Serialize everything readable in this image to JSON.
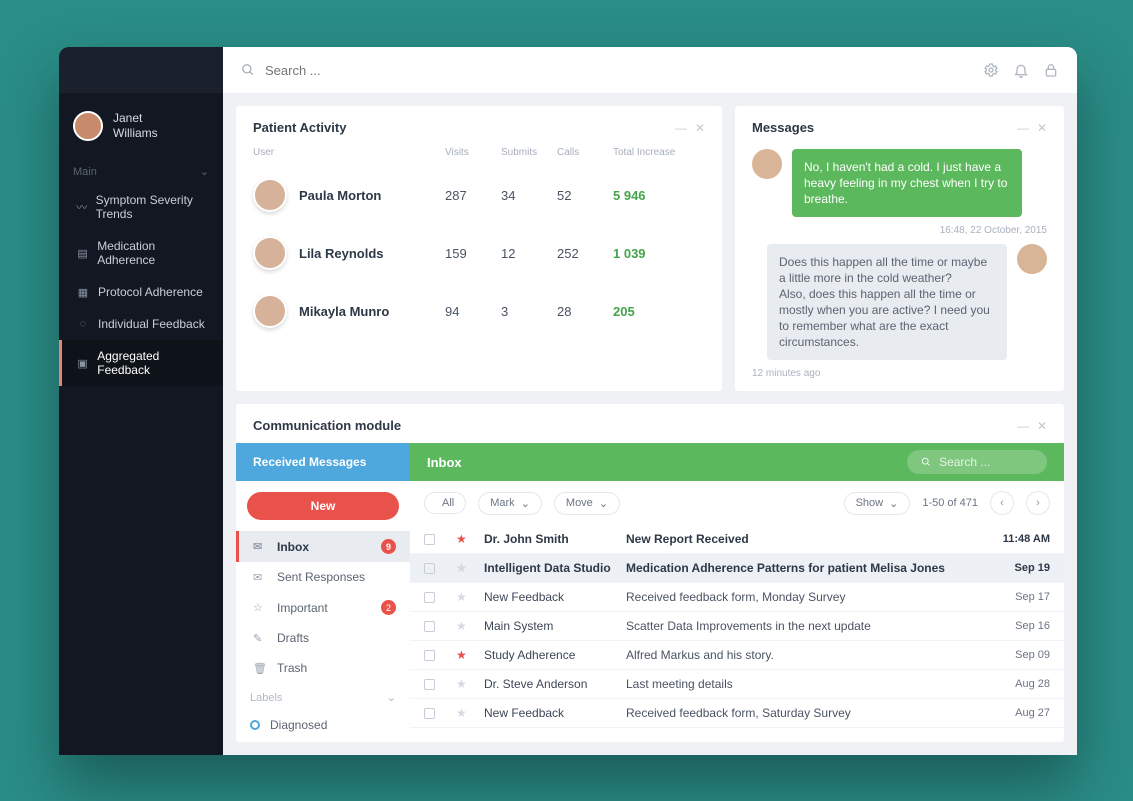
{
  "search_placeholder": "Search ...",
  "user": {
    "first": "Janet",
    "last": "Williams"
  },
  "sidebar": {
    "group": "Main",
    "items": [
      {
        "label": "Symptom Severity Trends"
      },
      {
        "label": "Medication Adherence"
      },
      {
        "label": "Protocol Adherence"
      },
      {
        "label": "Individual Feedback"
      },
      {
        "label": "Aggregated Feedback"
      }
    ]
  },
  "patient_activity": {
    "title": "Patient Activity",
    "columns": {
      "user": "User",
      "visits": "Visits",
      "submits": "Submits",
      "calls": "Calls",
      "total": "Total Increase"
    },
    "rows": [
      {
        "name": "Paula Morton",
        "visits": "287",
        "submits": "34",
        "calls": "52",
        "total": "5 946"
      },
      {
        "name": "Lila Reynolds",
        "visits": "159",
        "submits": "12",
        "calls": "252",
        "total": "1 039"
      },
      {
        "name": "Mikayla Munro",
        "visits": "94",
        "submits": "3",
        "calls": "28",
        "total": "205"
      }
    ]
  },
  "messages": {
    "title": "Messages",
    "bubble_in": "No, I haven't had a cold. I just have a heavy feeling in my chest when I try to breathe.",
    "bubble_in_time": "16:48, 22 October, 2015",
    "bubble_out": "Does this happen all the time or maybe a little more in the cold weather?\nAlso, does this happen all the time or mostly when you are active? I need you to remember what are the exact circumstances.",
    "bubble_out_time": "12 minutes ago"
  },
  "comm": {
    "title": "Communication module",
    "tabs": {
      "received": "Received Messages",
      "inbox": "Inbox"
    },
    "search_placeholder": "Search ...",
    "new_btn": "New",
    "folders": {
      "inbox": {
        "label": "Inbox",
        "badge": "9"
      },
      "sent": {
        "label": "Sent Responses"
      },
      "important": {
        "label": "Important",
        "badge": "2"
      },
      "drafts": {
        "label": "Drafts"
      },
      "trash": {
        "label": "Trash"
      }
    },
    "labels_title": "Labels",
    "labels": [
      {
        "name": "Diagnosed"
      }
    ],
    "toolbar": {
      "all": "All",
      "mark": "Mark",
      "move": "Move",
      "show": "Show",
      "range": "1-50 of 471"
    },
    "mails": [
      {
        "starred": true,
        "from": "Dr. John Smith",
        "subj": "New Report Received",
        "date": "11:48 AM",
        "unread": true
      },
      {
        "starred": false,
        "from": "Intelligent Data Studio",
        "subj": "Medication Adherence Patterns for patient Melisa Jones",
        "date": "Sep 19",
        "selected": true,
        "unread": true
      },
      {
        "starred": false,
        "from": "New Feedback",
        "subj": "Received feedback form, Monday Survey",
        "date": "Sep 17"
      },
      {
        "starred": false,
        "from": "Main System",
        "subj": "Scatter Data Improvements in the next update",
        "date": "Sep 16"
      },
      {
        "starred": true,
        "from": "Study Adherence",
        "subj": "Alfred Markus and his story.",
        "date": "Sep 09"
      },
      {
        "starred": false,
        "from": "Dr. Steve Anderson",
        "subj": "Last meeting details",
        "date": "Aug 28"
      },
      {
        "starred": false,
        "from": "New Feedback",
        "subj": "Received feedback form, Saturday Survey",
        "date": "Aug 27"
      }
    ]
  }
}
